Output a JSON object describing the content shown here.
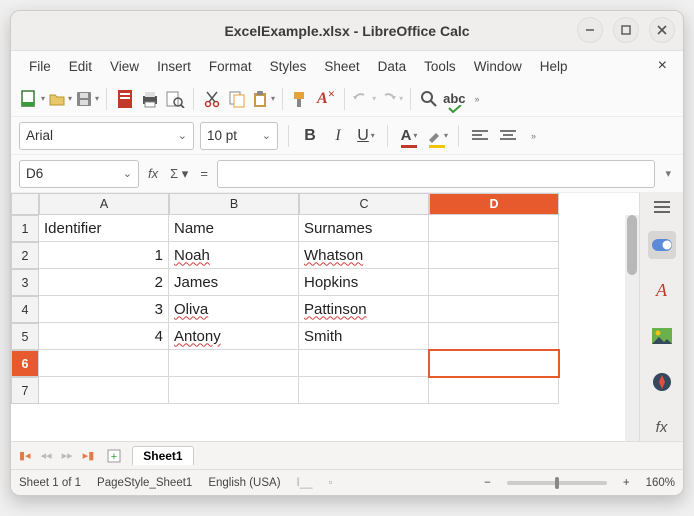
{
  "window": {
    "title": "ExcelExample.xlsx - LibreOffice Calc"
  },
  "menu": {
    "items": [
      "File",
      "Edit",
      "View",
      "Insert",
      "Format",
      "Styles",
      "Sheet",
      "Data",
      "Tools",
      "Window",
      "Help"
    ]
  },
  "format": {
    "font_name": "Arial",
    "font_size": "10 pt",
    "bold": "B",
    "italic": "I",
    "underline": "U"
  },
  "namebox": {
    "cell_ref": "D6",
    "fx": "fx",
    "sigma": "Σ",
    "eq": "="
  },
  "chart_data": {
    "type": "table",
    "columns": [
      "A",
      "B",
      "C",
      "D"
    ],
    "selected_cell": "D6",
    "rows": [
      {
        "n": "1",
        "A": "Identifier",
        "B": "Name",
        "C": "Surnames",
        "D": ""
      },
      {
        "n": "2",
        "A": "1",
        "B": "Noah",
        "C": "Whatson",
        "D": ""
      },
      {
        "n": "3",
        "A": "2",
        "B": "James",
        "C": "Hopkins",
        "D": ""
      },
      {
        "n": "4",
        "A": "3",
        "B": "Oliva",
        "C": "Pattinson",
        "D": ""
      },
      {
        "n": "5",
        "A": "4",
        "B": "Antony",
        "C": "Smith",
        "D": ""
      },
      {
        "n": "6",
        "A": "",
        "B": "",
        "C": "",
        "D": ""
      },
      {
        "n": "7",
        "A": "",
        "B": "",
        "C": "",
        "D": ""
      }
    ]
  },
  "tabs": {
    "sheet": "Sheet1"
  },
  "status": {
    "sheet_count": "Sheet 1 of 1",
    "page_style": "PageStyle_Sheet1",
    "language": "English (USA)",
    "zoom": "160%"
  },
  "colors": {
    "accent": "#e65a2e"
  }
}
